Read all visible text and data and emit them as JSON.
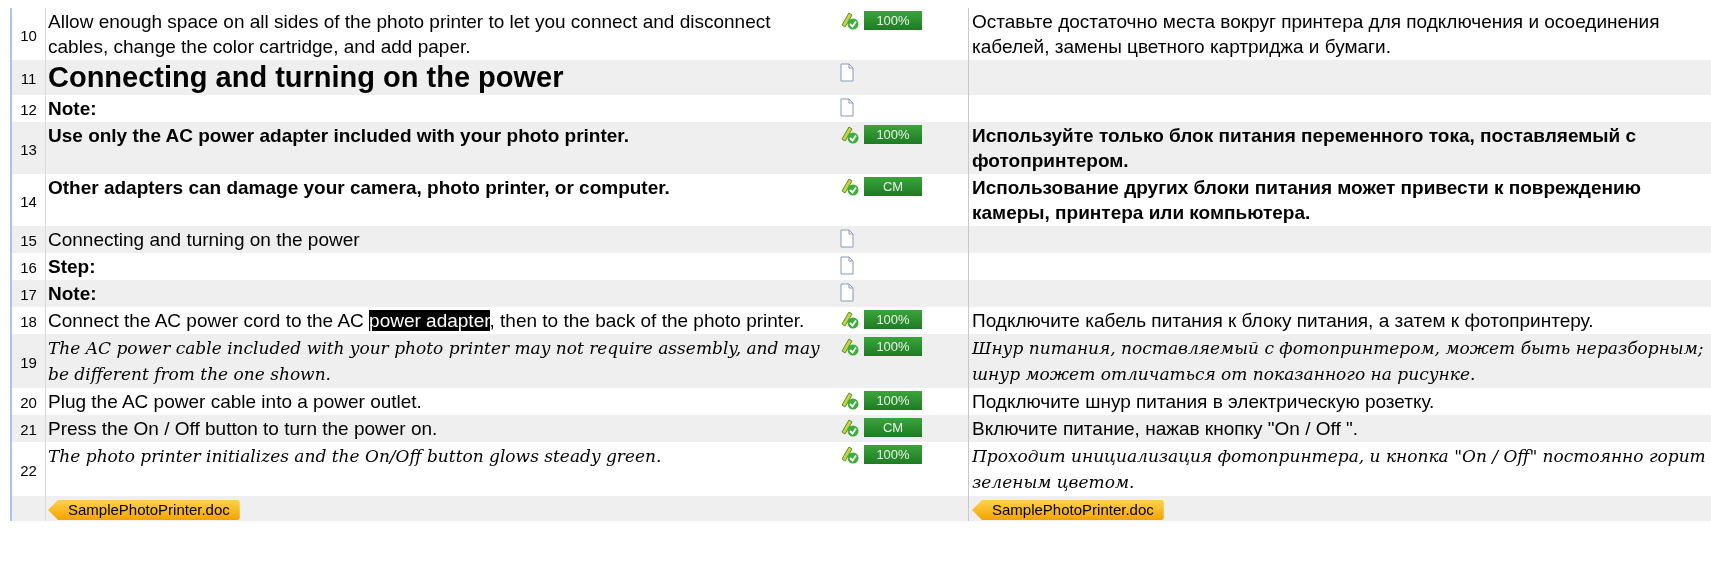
{
  "rows": [
    {
      "number": "10",
      "kind": "normal",
      "source": [
        {
          "text": "Allow enough space on all sides of the photo printer to let you connect and disconnect cables, change the color cartridge, and add paper.",
          "selected": false
        }
      ],
      "status": {
        "kind": "match",
        "label": "100%"
      },
      "target": "Оставьте достаточно места вокруг принтера для подключения и осоединения кабелей, замены цветного картриджа и бумаги."
    },
    {
      "number": "11",
      "kind": "heading",
      "source": [
        {
          "text": "Connecting and turning on the power",
          "selected": false
        }
      ],
      "status": {
        "kind": "empty"
      }
    },
    {
      "number": "12",
      "kind": "bold",
      "source": [
        {
          "text": "Note:",
          "selected": false
        }
      ],
      "status": {
        "kind": "empty"
      }
    },
    {
      "number": "13",
      "kind": "bold",
      "source": [
        {
          "text": "Use only the AC power adapter included with your photo printer.",
          "selected": false
        }
      ],
      "status": {
        "kind": "match",
        "label": "100%"
      },
      "target": "Используйте только блок питания переменного тока, поставляемый с фотопринтером."
    },
    {
      "number": "14",
      "kind": "bold",
      "source": [
        {
          "text": "Other adapters can damage your camera, photo printer, or computer.",
          "selected": false
        }
      ],
      "status": {
        "kind": "match",
        "label": "CM"
      },
      "target": "Использование других блоки питания может привести к повреждению камеры, принтера или компьютера."
    },
    {
      "number": "15",
      "kind": "normal",
      "source": [
        {
          "text": "Connecting and turning on the power",
          "selected": false
        }
      ],
      "status": {
        "kind": "empty"
      }
    },
    {
      "number": "16",
      "kind": "bold",
      "source": [
        {
          "text": "Step:",
          "selected": false
        }
      ],
      "status": {
        "kind": "empty"
      }
    },
    {
      "number": "17",
      "kind": "bold",
      "source": [
        {
          "text": "Note:",
          "selected": false
        }
      ],
      "status": {
        "kind": "empty"
      }
    },
    {
      "number": "18",
      "kind": "normal",
      "source": [
        {
          "text": "Connect the AC power cord to the AC ",
          "selected": false
        },
        {
          "text": "power adapter",
          "selected": true
        },
        {
          "text": ", then to the back of the photo printer.",
          "selected": false
        }
      ],
      "status": {
        "kind": "match",
        "label": "100%"
      },
      "target": "Подключите кабель питания к блоку питания, а затем к фотопринтеру."
    },
    {
      "number": "19",
      "kind": "italic",
      "source": [
        {
          "text": "The AC power cable included with your photo printer may not require assembly, and may be different from the one shown.",
          "selected": false
        }
      ],
      "status": {
        "kind": "match",
        "label": "100%"
      },
      "target": "Шнур питания, поставляемый с фотопринтером, может  быть неразборным; шнур может отличаться от показанного на рисунке."
    },
    {
      "number": "20",
      "kind": "normal",
      "source": [
        {
          "text": "Plug the AC power cable into a power outlet.",
          "selected": false
        }
      ],
      "status": {
        "kind": "match",
        "label": "100%"
      },
      "target": "Подключите шнур питания в электрическую розетку."
    },
    {
      "number": "21",
      "kind": "normal",
      "source": [
        {
          "text": "Press the On / Off button to turn the power on.",
          "selected": false
        }
      ],
      "status": {
        "kind": "match",
        "label": "CM"
      },
      "target": "Включите питание, нажав кнопку  \"On / Off \"."
    },
    {
      "number": "22",
      "kind": "italic",
      "source": [
        {
          "text": "The photo printer initializes and the On/Off button glows steady green.",
          "selected": false
        }
      ],
      "status": {
        "kind": "match",
        "label": "100%"
      },
      "target": "Проходит инициализация фотопринтера, и кнопка  \"On / Off\" постоянно горит зеленым цветом."
    }
  ],
  "footer": {
    "source_file": "SamplePhotoPrinter.doc",
    "target_file": "SamplePhotoPrinter.doc"
  }
}
